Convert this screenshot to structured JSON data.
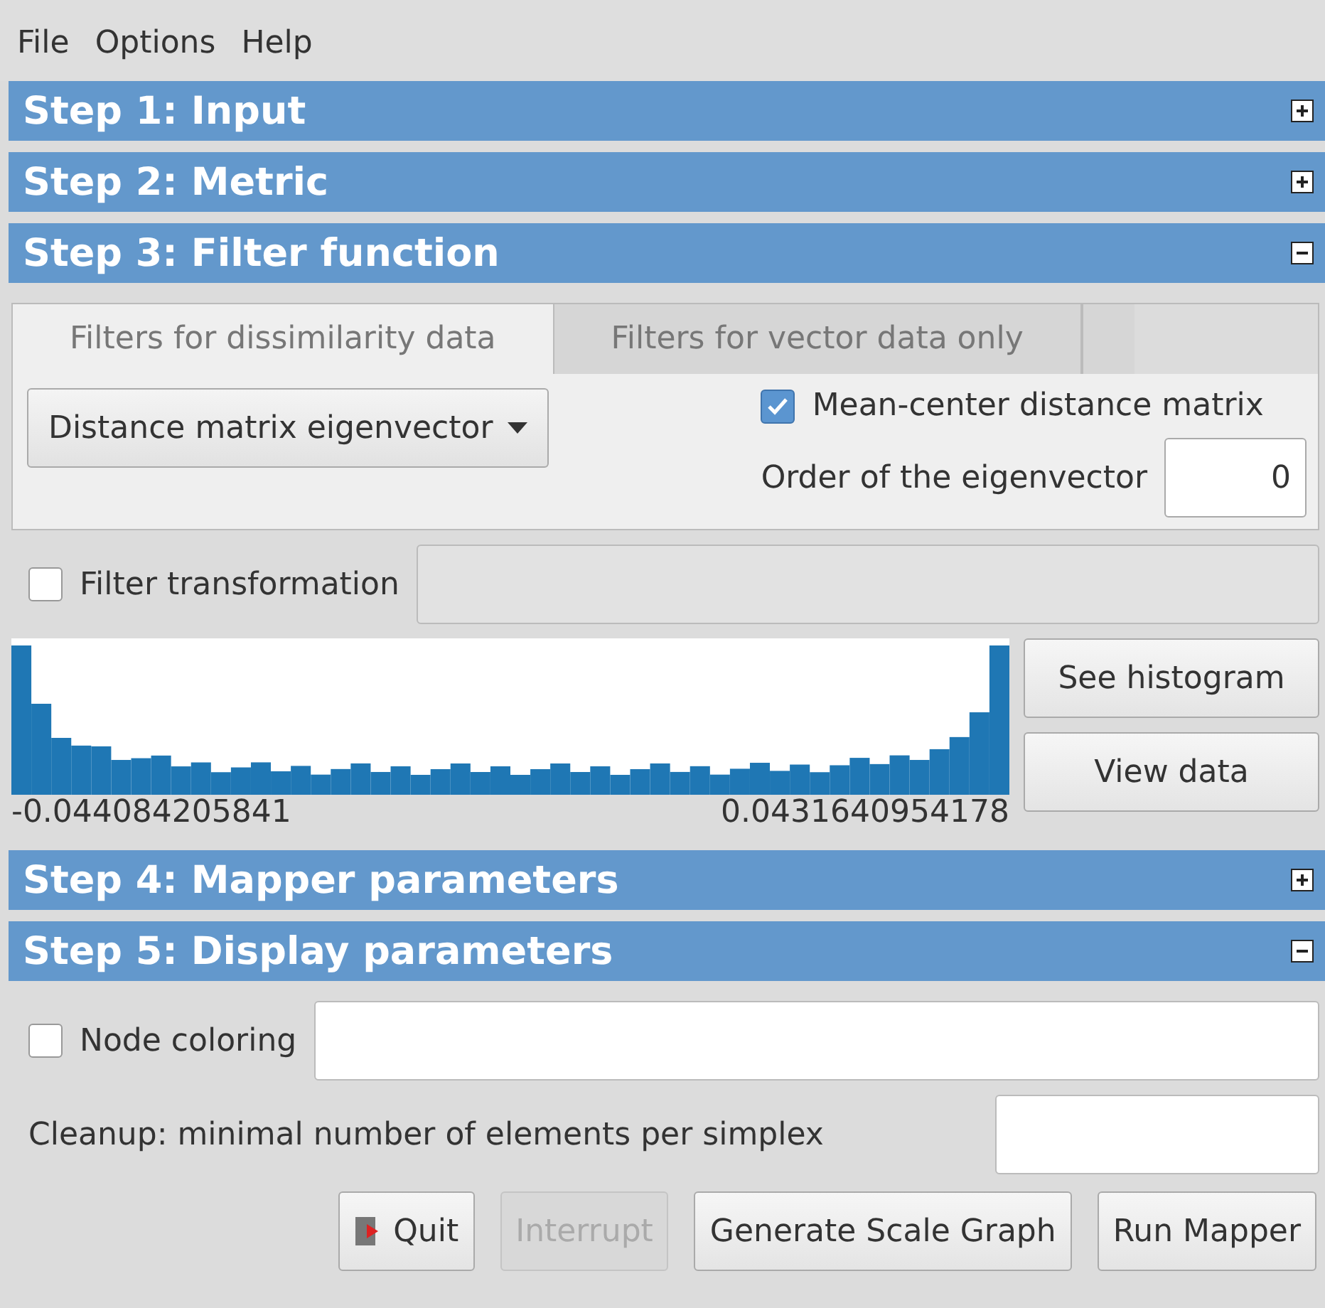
{
  "menu": [
    "File",
    "Options",
    "Help"
  ],
  "steps": [
    {
      "title": "Step 1: Input",
      "expanded": false
    },
    {
      "title": "Step 2: Metric",
      "expanded": false
    },
    {
      "title": "Step 3: Filter function",
      "expanded": true,
      "kind": "filter",
      "tabs": [
        {
          "label": "Filters for dissimilarity data",
          "selected": true
        },
        {
          "label": "Filters for vector data only",
          "selected": false
        }
      ],
      "filter_dropdown": "Distance matrix eigenvector",
      "mean_center": {
        "label": "Mean-center distance matrix",
        "checked": true
      },
      "order": {
        "label": "Order of the eigenvector",
        "value": "0"
      },
      "transformation": {
        "label": "Filter transformation",
        "checked": false
      },
      "histogram": {
        "min_label": "-0.044084205841",
        "max_label": "0.0431640954178"
      },
      "buttons": [
        "See histogram",
        "View data"
      ]
    },
    {
      "title": "Step 4: Mapper parameters",
      "expanded": false
    },
    {
      "title": "Step 5: Display parameters",
      "expanded": true,
      "kind": "display",
      "node_coloring": {
        "label": "Node coloring",
        "checked": false
      },
      "cleanup": {
        "label": "Cleanup: minimal number of elements per simplex"
      }
    }
  ],
  "actions": [
    {
      "label": "Quit",
      "disabled": false,
      "kind": "icon"
    },
    {
      "label": "Interrupt",
      "disabled": true,
      "kind": "plain"
    },
    {
      "label": "Generate Scale Graph",
      "disabled": false,
      "kind": "plain"
    },
    {
      "label": "Run Mapper",
      "disabled": false,
      "kind": "plain"
    }
  ]
}
